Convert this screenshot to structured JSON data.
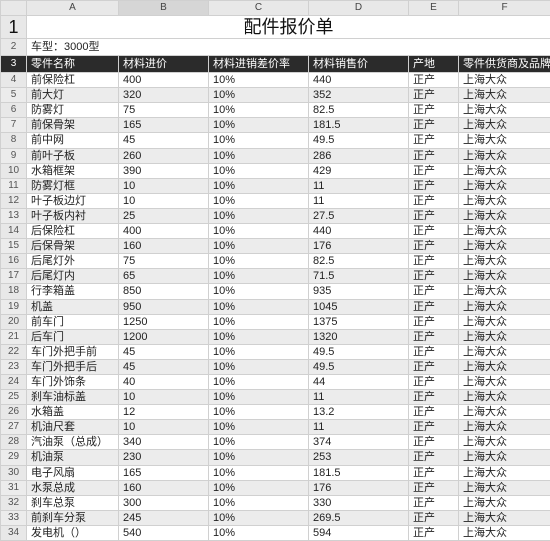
{
  "column_letters": [
    "A",
    "B",
    "C",
    "D",
    "E",
    "F"
  ],
  "title": "配件报价单",
  "model_line": "车型：3000型",
  "headers": [
    "零件名称",
    "材料进价",
    "材料进销差价率",
    "材料销售价",
    "产地",
    "零件供货商及品牌"
  ],
  "rows": [
    {
      "n": 4,
      "c": [
        "前保险杠",
        "400",
        "10%",
        "440",
        "正产",
        "上海大众"
      ]
    },
    {
      "n": 5,
      "c": [
        "前大灯",
        "320",
        "10%",
        "352",
        "正产",
        "上海大众"
      ]
    },
    {
      "n": 6,
      "c": [
        "防雾灯",
        "75",
        "10%",
        "82.5",
        "正产",
        "上海大众"
      ]
    },
    {
      "n": 7,
      "c": [
        "前保骨架",
        "165",
        "10%",
        "181.5",
        "正产",
        "上海大众"
      ]
    },
    {
      "n": 8,
      "c": [
        "前中网",
        "45",
        "10%",
        "49.5",
        "正产",
        "上海大众"
      ]
    },
    {
      "n": 9,
      "c": [
        "前叶子板",
        "260",
        "10%",
        "286",
        "正产",
        "上海大众"
      ]
    },
    {
      "n": 10,
      "c": [
        "水箱框架",
        "390",
        "10%",
        "429",
        "正产",
        "上海大众"
      ]
    },
    {
      "n": 11,
      "c": [
        "防雾灯框",
        "10",
        "10%",
        "11",
        "正产",
        "上海大众"
      ]
    },
    {
      "n": 12,
      "c": [
        "叶子板边灯",
        "10",
        "10%",
        "11",
        "正产",
        "上海大众"
      ]
    },
    {
      "n": 13,
      "c": [
        "叶子板内衬",
        "25",
        "10%",
        "27.5",
        "正产",
        "上海大众"
      ]
    },
    {
      "n": 14,
      "c": [
        "后保险杠",
        "400",
        "10%",
        "440",
        "正产",
        "上海大众"
      ]
    },
    {
      "n": 15,
      "c": [
        "后保骨架",
        "160",
        "10%",
        "176",
        "正产",
        "上海大众"
      ]
    },
    {
      "n": 16,
      "c": [
        "后尾灯外",
        "75",
        "10%",
        "82.5",
        "正产",
        "上海大众"
      ]
    },
    {
      "n": 17,
      "c": [
        "后尾灯内",
        "65",
        "10%",
        "71.5",
        "正产",
        "上海大众"
      ]
    },
    {
      "n": 18,
      "c": [
        "行李箱盖",
        "850",
        "10%",
        "935",
        "正产",
        "上海大众"
      ]
    },
    {
      "n": 19,
      "c": [
        "机盖",
        "950",
        "10%",
        "1045",
        "正产",
        "上海大众"
      ]
    },
    {
      "n": 20,
      "c": [
        "前车门",
        "1250",
        "10%",
        "1375",
        "正产",
        "上海大众"
      ]
    },
    {
      "n": 21,
      "c": [
        "后车门",
        "1200",
        "10%",
        "1320",
        "正产",
        "上海大众"
      ]
    },
    {
      "n": 22,
      "c": [
        "车门外把手前",
        "45",
        "10%",
        "49.5",
        "正产",
        "上海大众"
      ]
    },
    {
      "n": 23,
      "c": [
        "车门外把手后",
        "45",
        "10%",
        "49.5",
        "正产",
        "上海大众"
      ]
    },
    {
      "n": 24,
      "c": [
        "车门外饰条",
        "40",
        "10%",
        "44",
        "正产",
        "上海大众"
      ]
    },
    {
      "n": 25,
      "c": [
        "刹车油标盖",
        "10",
        "10%",
        "11",
        "正产",
        "上海大众"
      ]
    },
    {
      "n": 26,
      "c": [
        "水箱盖",
        "12",
        "10%",
        "13.2",
        "正产",
        "上海大众"
      ]
    },
    {
      "n": 27,
      "c": [
        "机油尺套",
        "10",
        "10%",
        "11",
        "正产",
        "上海大众"
      ]
    },
    {
      "n": 28,
      "c": [
        "汽油泵（总成）",
        "340",
        "10%",
        "374",
        "正产",
        "上海大众"
      ]
    },
    {
      "n": 29,
      "c": [
        "机油泵",
        "230",
        "10%",
        "253",
        "正产",
        "上海大众"
      ]
    },
    {
      "n": 30,
      "c": [
        "电子风扇",
        "165",
        "10%",
        "181.5",
        "正产",
        "上海大众"
      ]
    },
    {
      "n": 31,
      "c": [
        "水泵总成",
        "160",
        "10%",
        "176",
        "正产",
        "上海大众"
      ]
    },
    {
      "n": 32,
      "c": [
        "刹车总泵",
        "300",
        "10%",
        "330",
        "正产",
        "上海大众"
      ]
    },
    {
      "n": 33,
      "c": [
        "前刹车分泵",
        "245",
        "10%",
        "269.5",
        "正产",
        "上海大众"
      ]
    },
    {
      "n": 34,
      "c": [
        "发电机（）",
        "540",
        "10%",
        "594",
        "正产",
        "上海大众"
      ]
    }
  ]
}
